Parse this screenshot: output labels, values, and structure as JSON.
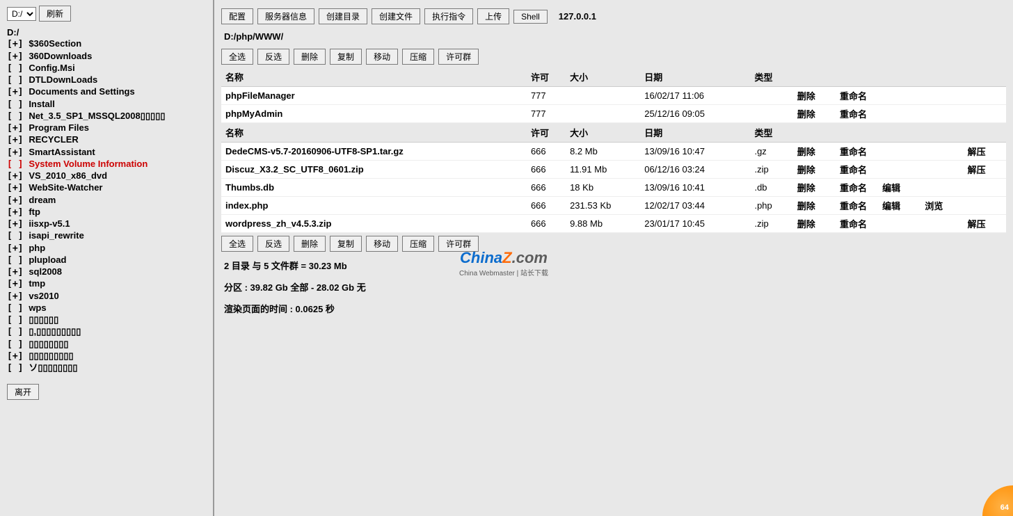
{
  "sidebar": {
    "drive_selected": "D:/",
    "refresh_label": "刷新",
    "root_label": "D:/",
    "items": [
      {
        "prefix": "[+]",
        "label": "$360Section"
      },
      {
        "prefix": "[+]",
        "label": "360Downloads"
      },
      {
        "prefix": "[ ]",
        "label": "Config.Msi"
      },
      {
        "prefix": "[ ]",
        "label": "DTLDownLoads"
      },
      {
        "prefix": "[+]",
        "label": "Documents and Settings"
      },
      {
        "prefix": "[ ]",
        "label": "Install"
      },
      {
        "prefix": "[ ]",
        "label": "Net_3.5_SP1_MSSQL2008▯▯▯▯▯"
      },
      {
        "prefix": "[+]",
        "label": "Program Files"
      },
      {
        "prefix": "[+]",
        "label": "RECYCLER"
      },
      {
        "prefix": "[+]",
        "label": "SmartAssistant"
      },
      {
        "prefix": "[ ]",
        "label": "System Volume Information",
        "special": true
      },
      {
        "prefix": "[+]",
        "label": "VS_2010_x86_dvd"
      },
      {
        "prefix": "[+]",
        "label": "WebSite-Watcher"
      },
      {
        "prefix": "[+]",
        "label": "dream"
      },
      {
        "prefix": "[+]",
        "label": "ftp"
      },
      {
        "prefix": "[+]",
        "label": "iisxp-v5.1"
      },
      {
        "prefix": "[ ]",
        "label": "isapi_rewrite"
      },
      {
        "prefix": "[+]",
        "label": "php"
      },
      {
        "prefix": "[ ]",
        "label": "plupload"
      },
      {
        "prefix": "[+]",
        "label": "sql2008"
      },
      {
        "prefix": "[+]",
        "label": "tmp"
      },
      {
        "prefix": "[+]",
        "label": "vs2010"
      },
      {
        "prefix": "[ ]",
        "label": "wps"
      },
      {
        "prefix": "[ ]",
        "label": "▯▯▯▯▯▯"
      },
      {
        "prefix": "[ ]",
        "label": "▯,▯▯▯▯▯▯▯▯▯"
      },
      {
        "prefix": "[ ]",
        "label": "▯▯▯▯▯▯▯▯"
      },
      {
        "prefix": "[+]",
        "label": "▯▯▯▯▯▯▯▯▯"
      },
      {
        "prefix": "[ ]",
        "label": "ソ▯▯▯▯▯▯▯▯"
      }
    ],
    "depart_label": "离开"
  },
  "toolbar": {
    "buttons": [
      "配置",
      "服务器信息",
      "创建目录",
      "创建文件",
      "执行指令",
      "上传",
      "Shell"
    ],
    "ip": "127.0.0.1"
  },
  "breadcrumb": "D:/php/WWW/",
  "actions": {
    "select_all": "全选",
    "invert": "反选",
    "delete": "删除",
    "copy": "复制",
    "move": "移动",
    "compress": "压缩",
    "permgroup": "许可群"
  },
  "headers": {
    "name": "名称",
    "perm": "许可",
    "size": "大小",
    "date": "日期",
    "type": "类型"
  },
  "row_actions": {
    "delete": "删除",
    "rename": "重命名",
    "edit": "编辑",
    "view": "浏览",
    "extract": "解压"
  },
  "dirs": [
    {
      "name": "phpFileManager",
      "perm": "777",
      "date": "16/02/17 11:06"
    },
    {
      "name": "phpMyAdmin",
      "perm": "777",
      "date": "25/12/16 09:05"
    }
  ],
  "files": [
    {
      "name": "DedeCMS-v5.7-20160906-UTF8-SP1.tar.gz",
      "perm": "666",
      "size": "8.2 Mb",
      "date": "13/09/16 10:47",
      "type": ".gz",
      "extract": true
    },
    {
      "name": "Discuz_X3.2_SC_UTF8_0601.zip",
      "perm": "666",
      "size": "11.91 Mb",
      "date": "06/12/16 03:24",
      "type": ".zip",
      "extract": true
    },
    {
      "name": "Thumbs.db",
      "perm": "666",
      "size": "18 Kb",
      "date": "13/09/16 10:41",
      "type": ".db",
      "edit": true
    },
    {
      "name": "index.php",
      "perm": "666",
      "size": "231.53 Kb",
      "date": "12/02/17 03:44",
      "type": ".php",
      "edit": true,
      "view": true
    },
    {
      "name": "wordpress_zh_v4.5.3.zip",
      "perm": "666",
      "size": "9.88 Mb",
      "date": "23/01/17 10:45",
      "type": ".zip",
      "extract": true
    }
  ],
  "summary": {
    "line1": "2 目录 与 5 文件群 = 30.23 Mb",
    "line2": "分区 : 39.82 Gb 全部 - 28.02 Gb 无",
    "line3": "渲染页面的时间 : 0.0625 秒"
  },
  "watermark": {
    "brand_p1": "China",
    "brand_p2": "Z",
    "brand_p3": ".com",
    "sub": "China Webmaster | 站长下载"
  },
  "corner_badge": "64"
}
